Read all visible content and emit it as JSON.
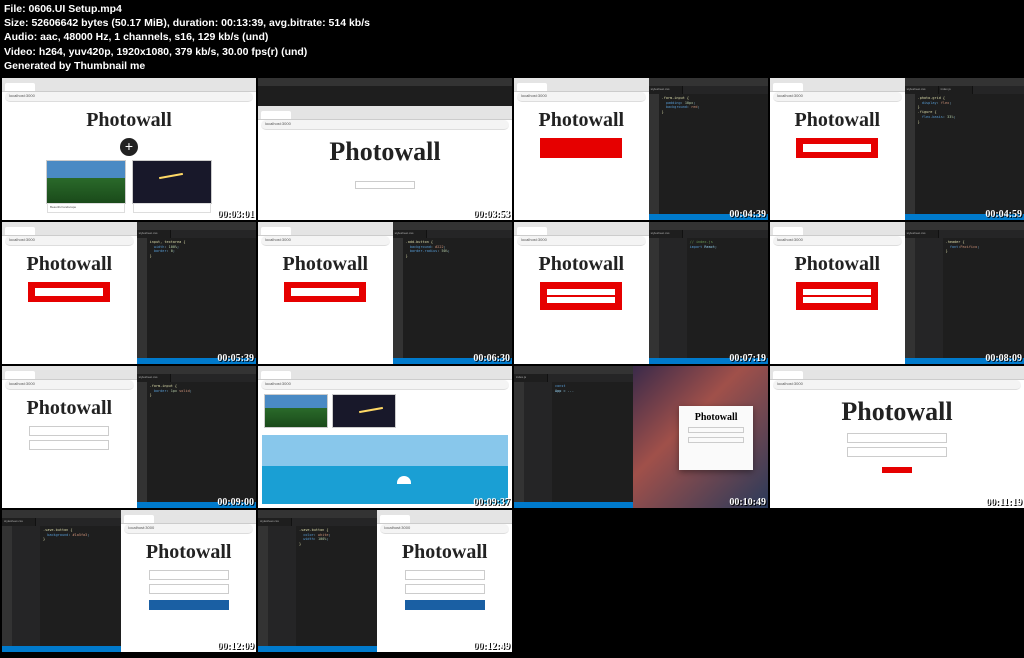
{
  "meta": {
    "file_label": "File:",
    "file_value": "0606.UI Setup.mp4",
    "size_label": "Size:",
    "size_value": "52606642 bytes (50.17 MiB),",
    "duration_label": "duration:",
    "duration_value": "00:13:39,",
    "avgbitrate_label": "avg.bitrate:",
    "avgbitrate_value": "514 kb/s",
    "audio_label": "Audio:",
    "audio_value": "aac, 48000 Hz, 1 channels, s16, 129 kb/s (und)",
    "video_label": "Video:",
    "video_value": "h264, yuv420p, 1920x1080, 379 kb/s, 30.00 fps(r) (und)",
    "generated": "Generated by Thumbnail me"
  },
  "app_logo": "Photowall",
  "browser": {
    "tab_title": "React App",
    "address": "localhost:3000"
  },
  "ide": {
    "tab1": "stylesheet.css",
    "tab2": "index.js",
    "status": ""
  },
  "code_css": [
    ".photo-grid {",
    "  display: flex;",
    "  flex-wrap: wrap;",
    "}",
    ".figure {",
    "  flex-basis: calc(33.333% - 4rem);",
    "  border: 1px solid #d3d3d3;",
    "}",
    ".form-input {",
    "  padding: 10px;",
    "  background-color: red;",
    "}",
    "input, textarea {",
    "  width: 100%;",
    "}"
  ],
  "timestamps": [
    "00:03:01",
    "00:03:53",
    "00:04:39",
    "00:04:59",
    "00:05:39",
    "00:06:30",
    "00:07:19",
    "00:08:09",
    "00:09:00",
    "00:09:37",
    "00:10:49",
    "00:11:19",
    "00:12:09",
    "00:12:49"
  ],
  "gallery_caption": "Beautiful landscape"
}
